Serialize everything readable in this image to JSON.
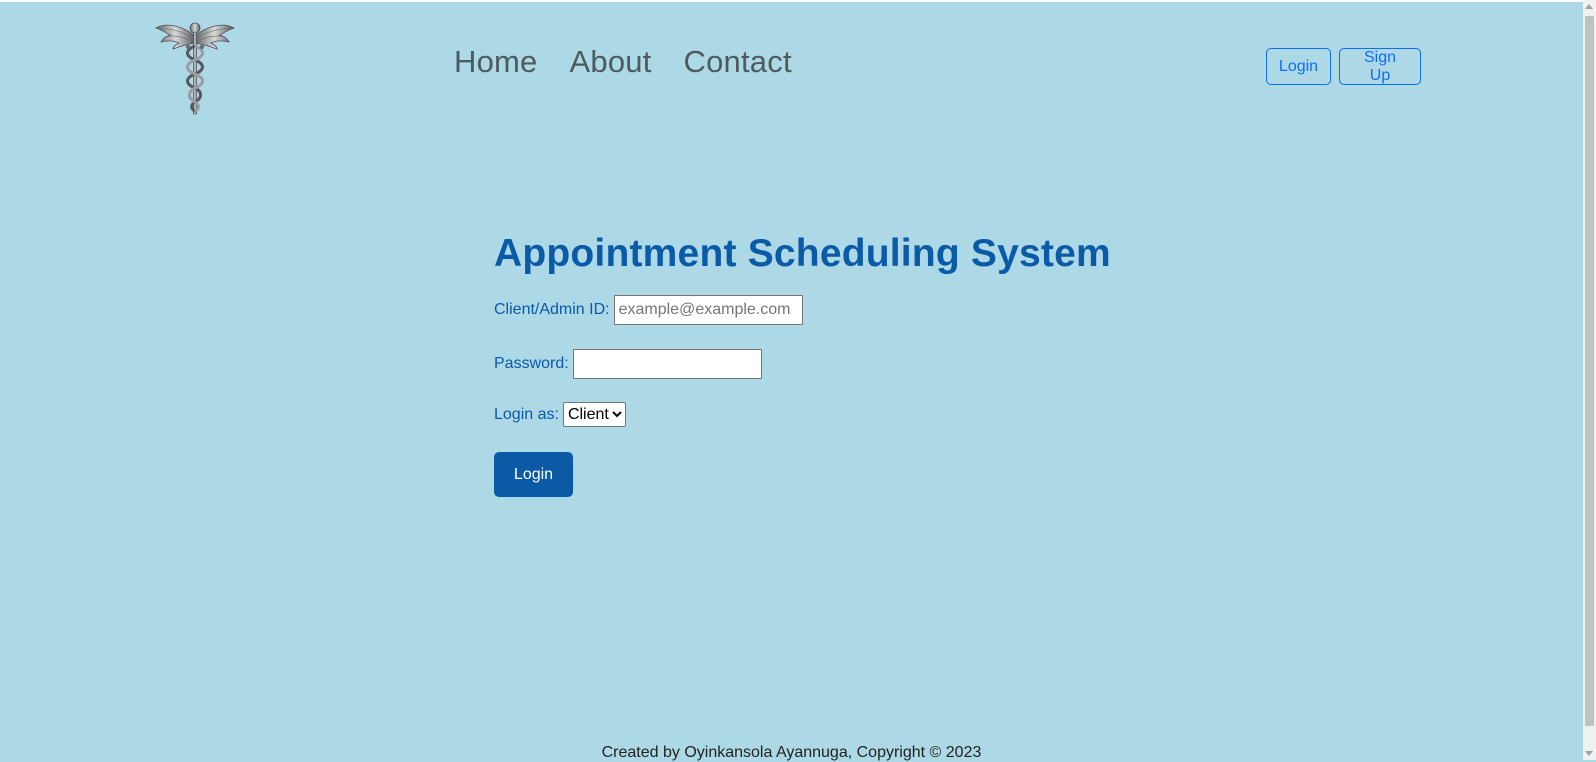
{
  "nav": {
    "links": [
      "Home",
      "About",
      "Contact"
    ]
  },
  "auth": {
    "login_label": "Login",
    "signup_label": "Sign Up"
  },
  "form": {
    "title": "Appointment Scheduling System",
    "id_label": "Client/Admin ID:",
    "id_placeholder": "example@example.com",
    "id_value": "",
    "password_label": "Password:",
    "password_value": "",
    "role_label": "Login as:",
    "role_selected": "Client",
    "submit_label": "Login"
  },
  "footer": {
    "text": "Created by Oyinkansola Ayannuga, Copyright © 2023"
  },
  "colors": {
    "background": "#add8e6",
    "heading": "#0a5aa8",
    "nav_text": "#4d5b5e",
    "outline_button": "#0d6efd",
    "primary_button": "#0b5aa6"
  },
  "icons": {
    "logo": "caduceus-icon"
  }
}
